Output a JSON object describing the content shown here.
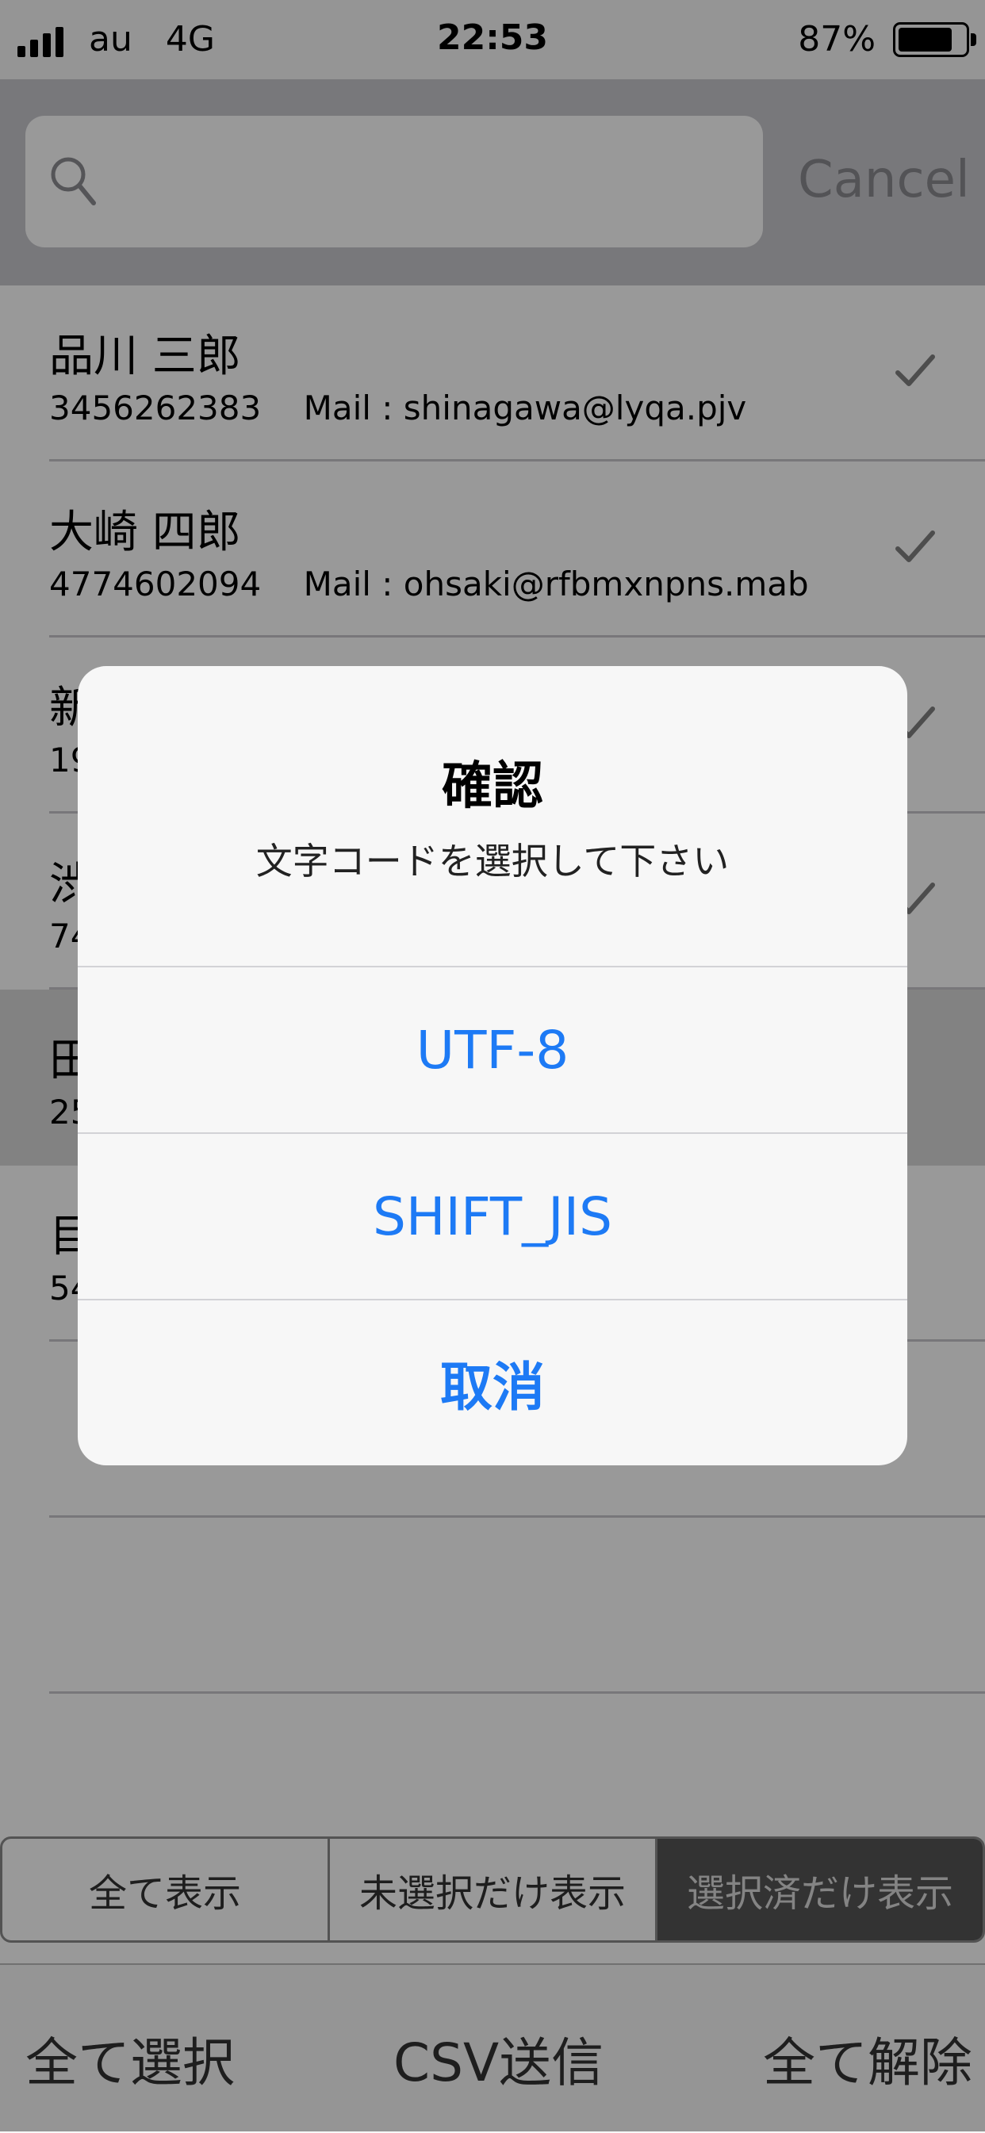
{
  "status": {
    "carrier": "au",
    "network": "4G",
    "time": "22:53",
    "battery": "87%",
    "battery_level": 0.87
  },
  "search": {
    "placeholder": "",
    "cancel_label": "Cancel"
  },
  "contacts": [
    {
      "name": "品川 三郎",
      "phone": "3456262383",
      "mail": "shinagawa@lyqa.pjv",
      "checked": true
    },
    {
      "name": "大崎 四郎",
      "phone": "4774602094",
      "mail": "ohsaki@rfbmxnpns.mab",
      "checked": true
    },
    {
      "name": "新",
      "phone": "19",
      "mail": "",
      "checked": true
    },
    {
      "name": "渋",
      "phone": "74",
      "mail": "",
      "checked": true
    },
    {
      "name": "田",
      "phone": "25",
      "mail": "",
      "checked": false
    },
    {
      "name": "目",
      "phone": "54",
      "mail": "",
      "checked": false
    }
  ],
  "segment": {
    "items": [
      "全て表示",
      "未選択だけ表示",
      "選択済だけ表示"
    ],
    "selected_index": 2
  },
  "toolbar": {
    "select_all": "全て選択",
    "csv_send": "CSV送信",
    "deselect_all": "全て解除"
  },
  "alert": {
    "title": "確認",
    "message": "文字コードを選択して下さい",
    "buttons": [
      "UTF-8",
      "SHIFT_JIS",
      "取消"
    ]
  },
  "colors": {
    "accent": "#1d7af5",
    "check": "#808080"
  }
}
